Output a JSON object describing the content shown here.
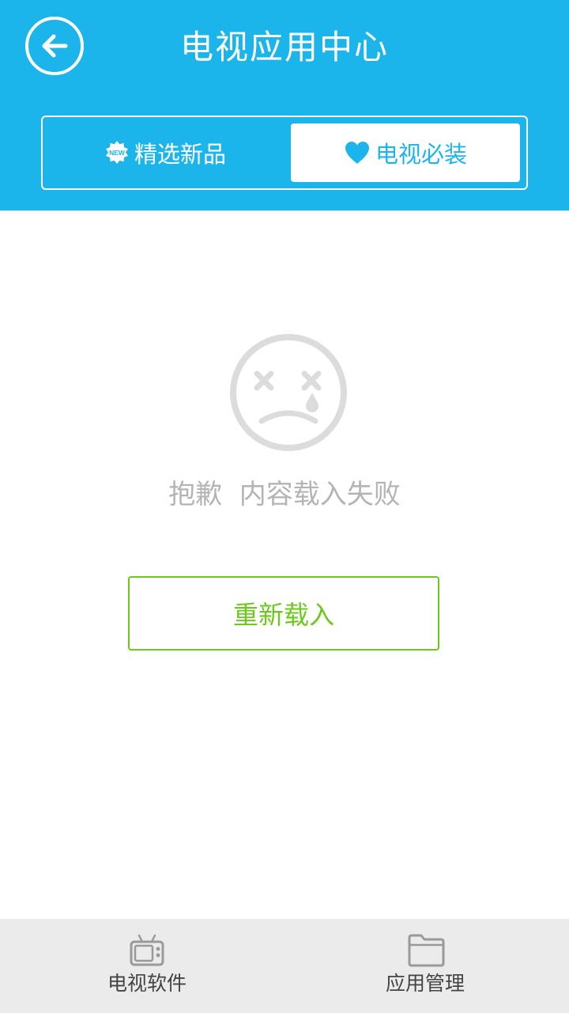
{
  "header": {
    "title": "电视应用中心",
    "back_icon": "arrow-left-icon",
    "background_color": "#1cb5eb"
  },
  "tabs": [
    {
      "label": "精选新品",
      "icon": "new-badge-icon",
      "icon_text": "NEW",
      "selected": false
    },
    {
      "label": "电视必装",
      "icon": "heart-icon",
      "selected": true
    }
  ],
  "error": {
    "icon": "sad-face-icon",
    "message": "抱歉  内容载入失败"
  },
  "reload_button": {
    "label": "重新载入",
    "color": "#6cc91b"
  },
  "bottom_nav": [
    {
      "label": "电视软件",
      "icon": "tv-icon"
    },
    {
      "label": "应用管理",
      "icon": "folder-icon"
    }
  ]
}
